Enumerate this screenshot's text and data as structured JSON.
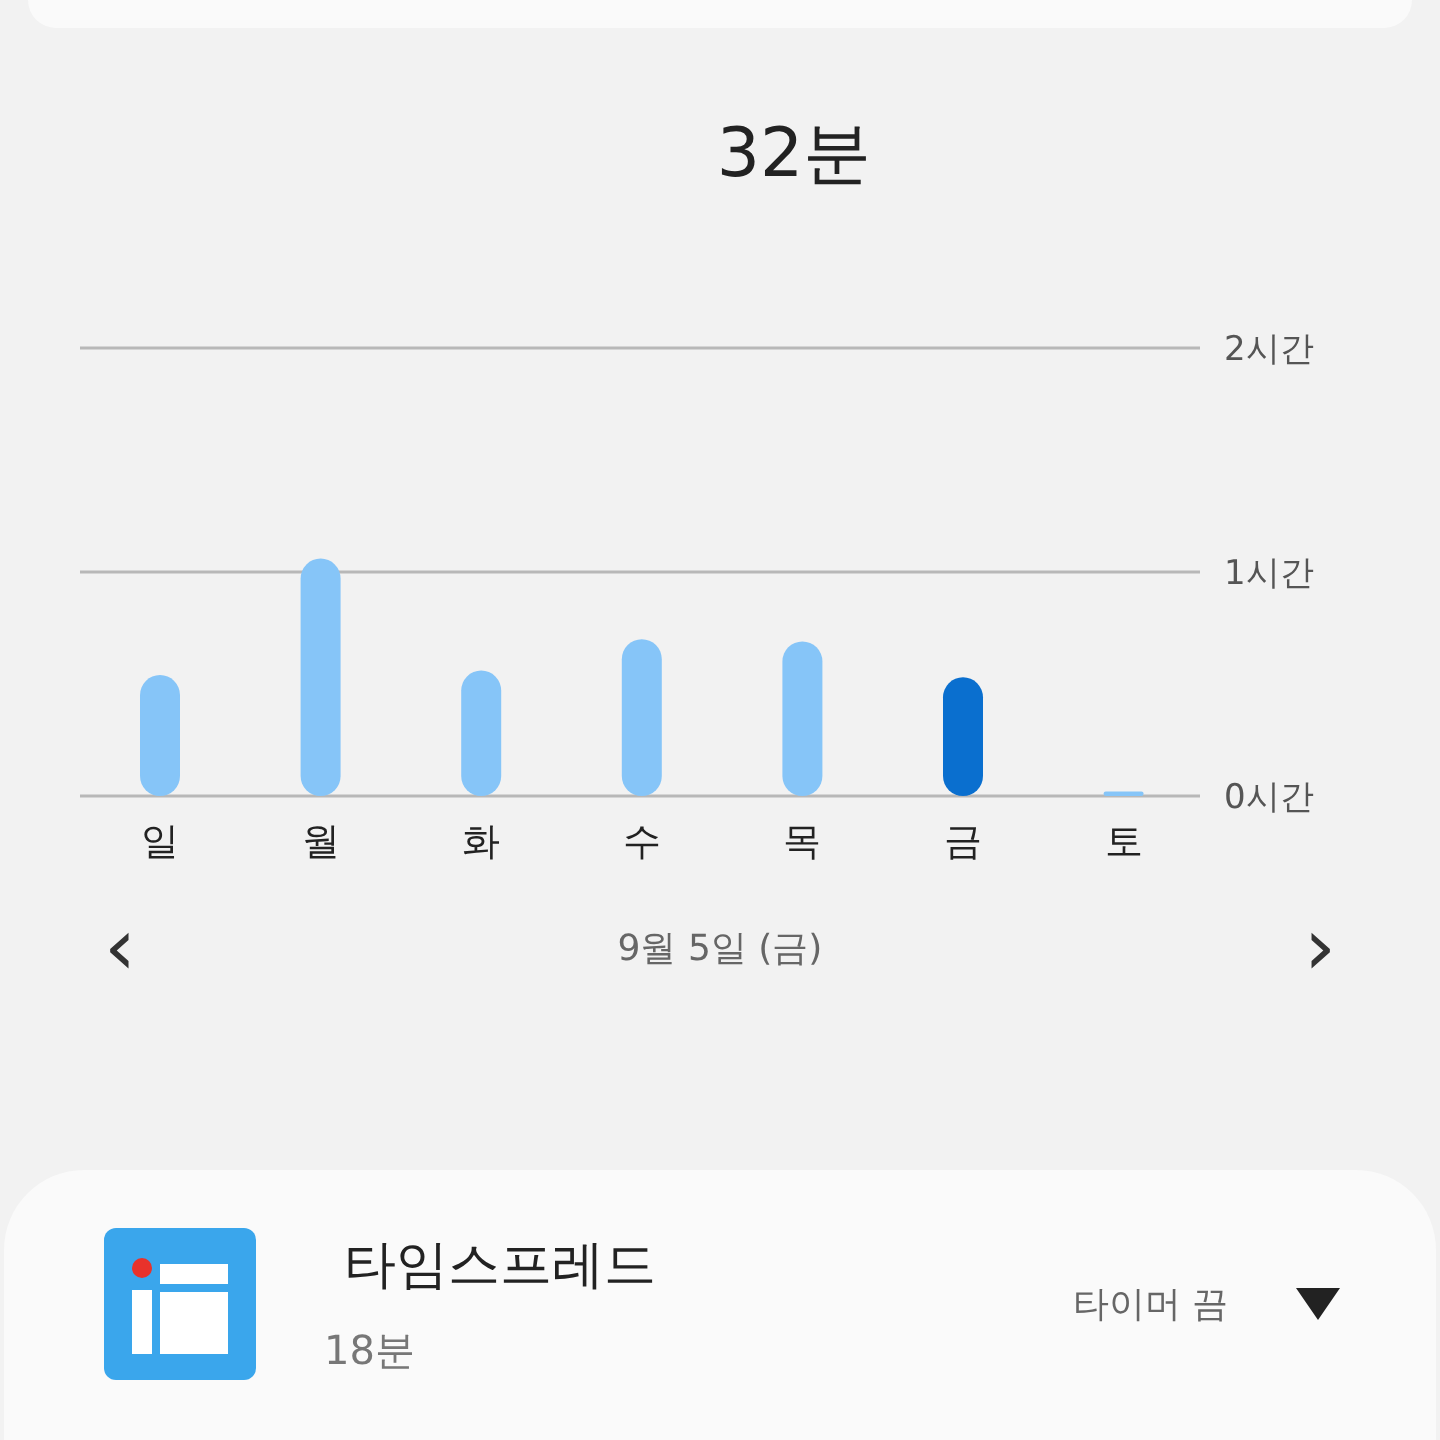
{
  "total": "32분",
  "usage_chart": {
    "chart_data": {
      "type": "bar",
      "categories": [
        "일",
        "월",
        "화",
        "수",
        "목",
        "금",
        "토"
      ],
      "series": [
        {
          "color": "#86c5f8",
          "values": [
            0.54,
            1.06,
            0.56,
            0.7,
            0.69,
            null,
            0.02
          ]
        },
        {
          "color": "#0a6fcf",
          "values": [
            null,
            null,
            null,
            null,
            null,
            0.53,
            null
          ]
        }
      ],
      "stacked": true,
      "ylim": [
        0,
        2
      ],
      "yticks": [
        {
          "value": 0,
          "label": "0시간"
        },
        {
          "value": 1,
          "label": "1시간"
        },
        {
          "value": 2,
          "label": "2시간"
        }
      ]
    }
  },
  "date_nav": {
    "previous": "‹",
    "date": "9월 5일 (금)",
    "next": "›"
  },
  "apps": [
    {
      "name": "타임스프레드",
      "time": "18분",
      "timer": "타이머 끔",
      "expanded": false
    }
  ]
}
